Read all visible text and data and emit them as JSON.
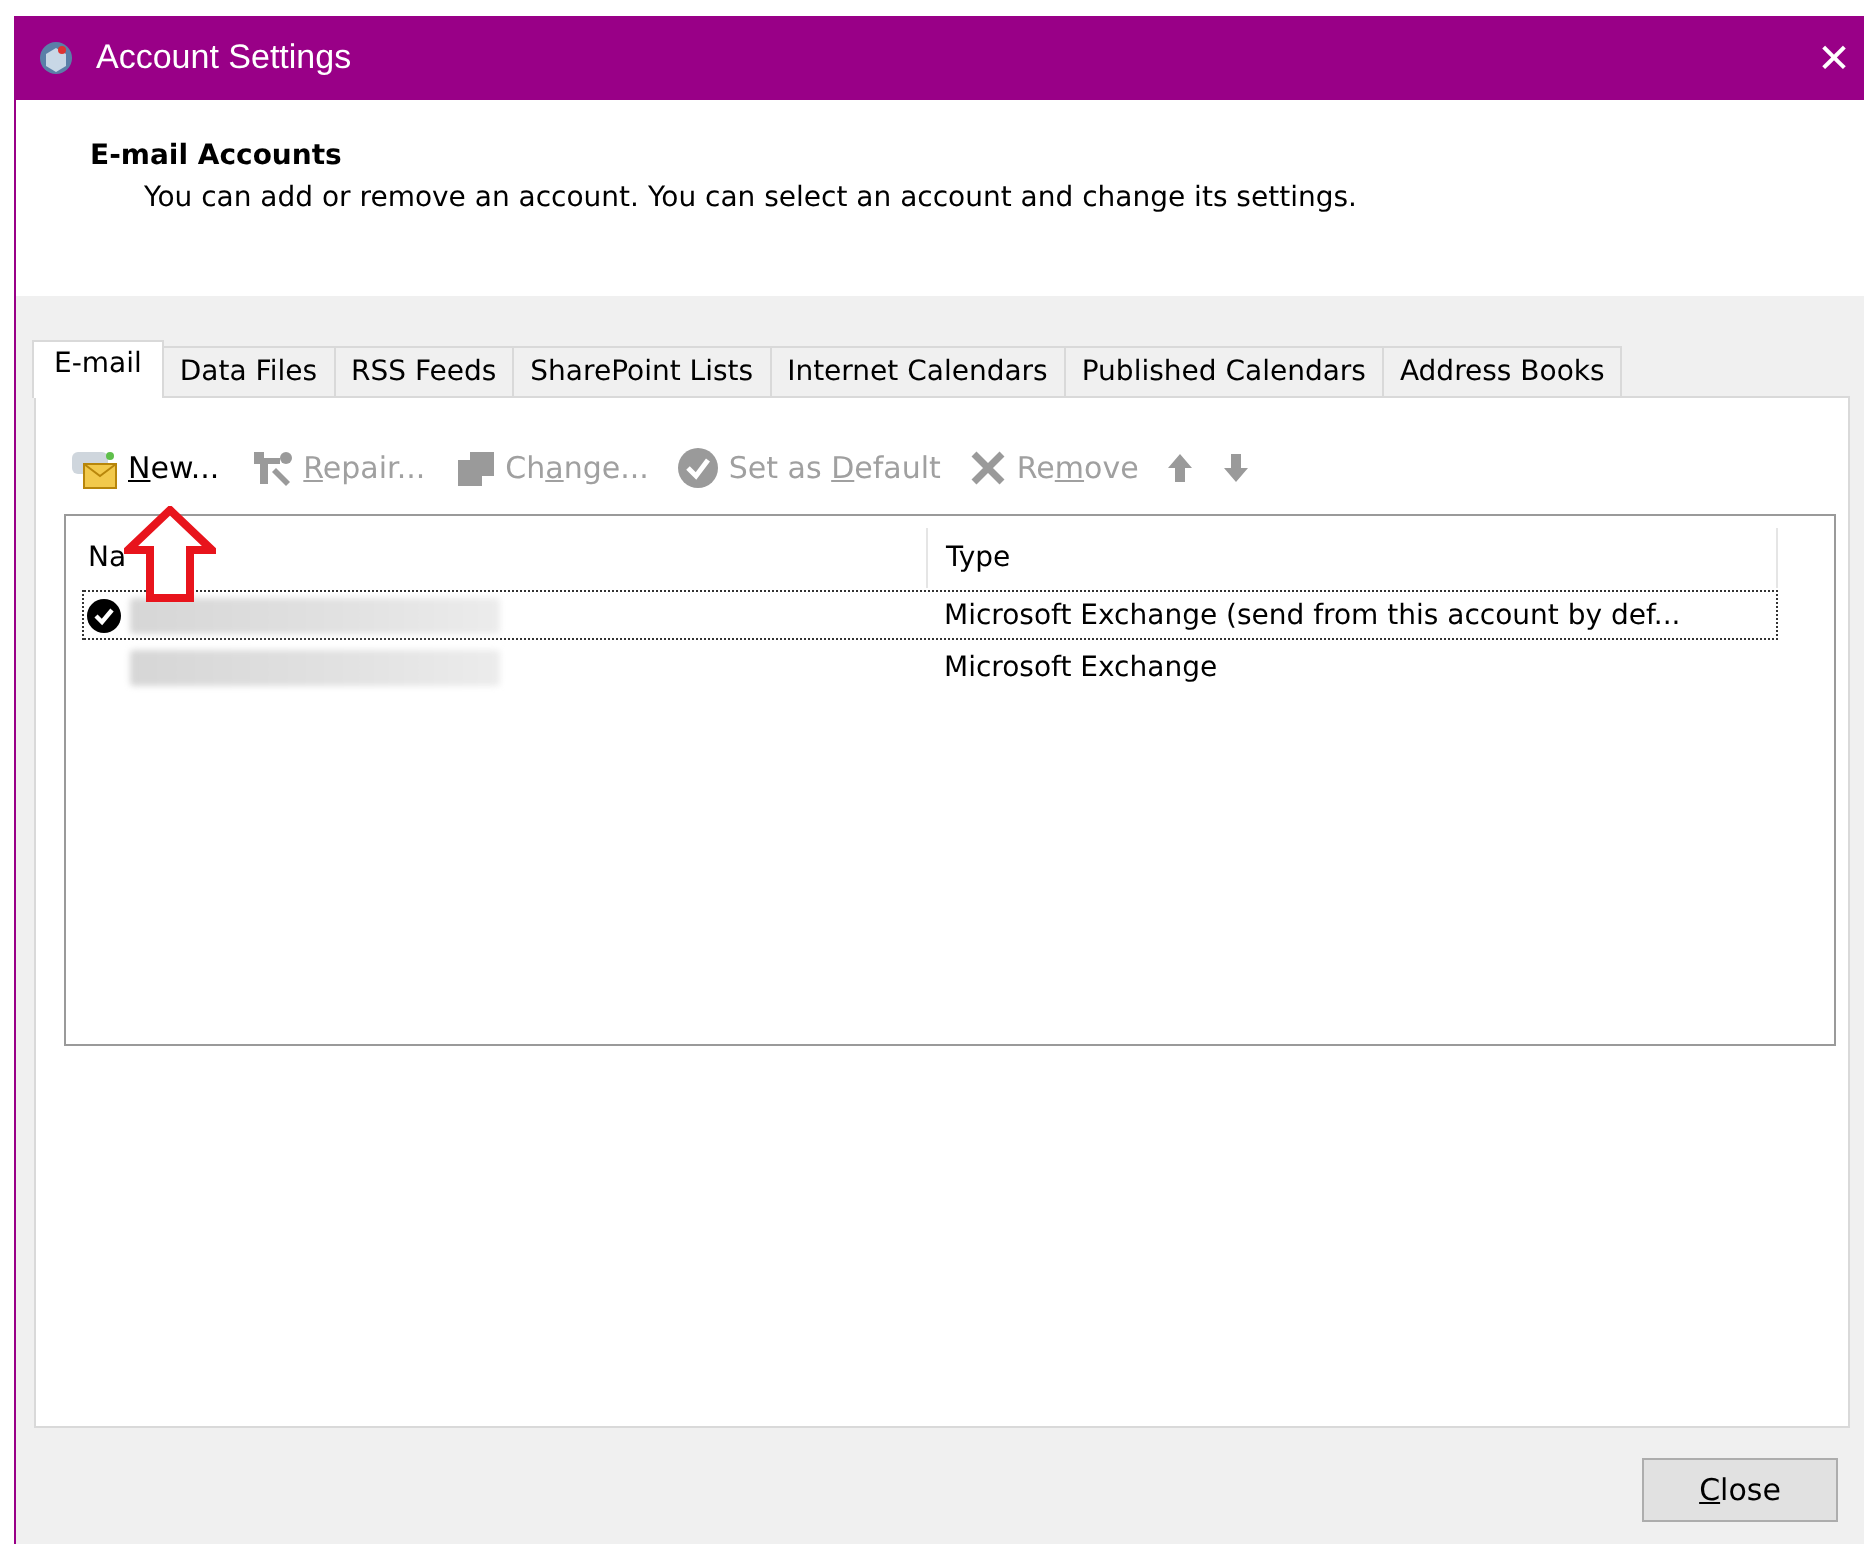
{
  "window": {
    "title": "Account Settings",
    "close_glyph": "✕"
  },
  "header": {
    "title": "E-mail Accounts",
    "description": "You can add or remove an account. You can select an account and change its settings."
  },
  "tabs": [
    {
      "label": "E-mail",
      "selected": true
    },
    {
      "label": "Data Files",
      "selected": false
    },
    {
      "label": "RSS Feeds",
      "selected": false
    },
    {
      "label": "SharePoint Lists",
      "selected": false
    },
    {
      "label": "Internet Calendars",
      "selected": false
    },
    {
      "label": "Published Calendars",
      "selected": false
    },
    {
      "label": "Address Books",
      "selected": false
    }
  ],
  "toolbar": [
    {
      "kind": "new",
      "label": {
        "key": "N",
        "after": "ew..."
      },
      "disabled": false
    },
    {
      "kind": "repair",
      "label": {
        "key": "R",
        "after": "epair..."
      },
      "disabled": true
    },
    {
      "kind": "change",
      "label": {
        "before": "Ch",
        "key": "a",
        "after": "nge..."
      },
      "disabled": true
    },
    {
      "kind": "default",
      "label": {
        "before": "Set as ",
        "key": "D",
        "after": "efault"
      },
      "disabled": true
    },
    {
      "kind": "remove",
      "label": {
        "before": "Re",
        "key": "m",
        "after": "ove"
      },
      "disabled": true
    },
    {
      "kind": "up",
      "disabled": true
    },
    {
      "kind": "down",
      "disabled": true
    }
  ],
  "table": {
    "columns": [
      "Na",
      "Type"
    ],
    "rows": [
      {
        "default": true,
        "selected": true,
        "type": "Microsoft Exchange (send from this account by def..."
      },
      {
        "default": false,
        "selected": false,
        "type": "Microsoft Exchange"
      }
    ]
  },
  "annotation": {
    "kind": "arrow"
  },
  "close_button": {
    "label": {
      "key": "C",
      "after": "lose"
    }
  }
}
